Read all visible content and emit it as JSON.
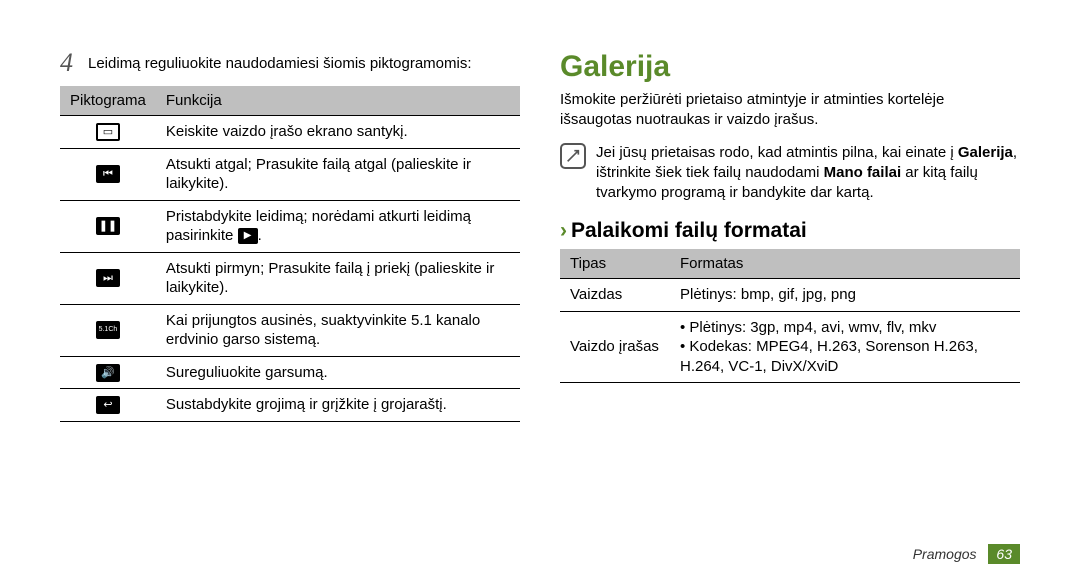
{
  "left": {
    "step_number": "4",
    "step_text": "Leidimą reguliuokite naudodamiesi šiomis piktogramomis:",
    "headers": {
      "col1": "Piktograma",
      "col2": "Funkcija"
    },
    "rows": [
      {
        "icon_name": "screen-ratio-icon",
        "glyph": "▭",
        "outline": true,
        "text": "Keiskite vaizdo įrašo ekrano santykį."
      },
      {
        "icon_name": "rewind-icon",
        "glyph": "⏮",
        "text": "Atsukti atgal; Prasukite failą atgal (palieskite ir laikykite)."
      },
      {
        "icon_name": "pause-icon",
        "glyph": "❚❚",
        "text_before": "Pristabdykite leidimą; norėdami atkurti leidimą pasirinkite ",
        "inline_icon": "▶",
        "inline_icon_name": "play-icon",
        "text_after": "."
      },
      {
        "icon_name": "forward-icon",
        "glyph": "⏭",
        "text": "Atsukti pirmyn; Prasukite failą į priekį (palieskite ir laikykite)."
      },
      {
        "icon_name": "surround-icon",
        "glyph": "5.1Ch",
        "small": true,
        "text": "Kai prijungtos ausinės, suaktyvinkite 5.1 kanalo erdvinio garso sistemą."
      },
      {
        "icon_name": "volume-icon",
        "glyph": "🔊",
        "text": "Sureguliuokite garsumą."
      },
      {
        "icon_name": "back-icon",
        "glyph": "↩",
        "text": "Sustabdykite grojimą ir grįžkite į grojaraštį."
      }
    ]
  },
  "right": {
    "title": "Galerija",
    "intro": "Išmokite peržiūrėti prietaiso atmintyje ir atminties kortelėje išsaugotas nuotraukas ir vaizdo įrašus.",
    "note_before": "Jei jūsų prietaisas rodo, kad atmintis pilna, kai einate į ",
    "note_bold1": "Galerija",
    "note_mid": ", ištrinkite šiek tiek failų naudodami ",
    "note_bold2": "Mano failai",
    "note_after": " ar kitą failų tvarkymo programą ir bandykite dar kartą.",
    "subheading": "Palaikomi failų formatai",
    "headers": {
      "col1": "Tipas",
      "col2": "Formatas"
    },
    "rows": [
      {
        "type": "Vaizdas",
        "format_plain": "Plėtinys: bmp, gif, jpg, png"
      },
      {
        "type": "Vaizdo įrašas",
        "format_list": [
          "Plėtinys: 3gp, mp4, avi, wmv, flv, mkv",
          "Kodekas: MPEG4, H.263, Sorenson H.263, H.264, VC-1, DivX/XviD"
        ]
      }
    ]
  },
  "footer": {
    "section": "Pramogos",
    "page": "63"
  }
}
